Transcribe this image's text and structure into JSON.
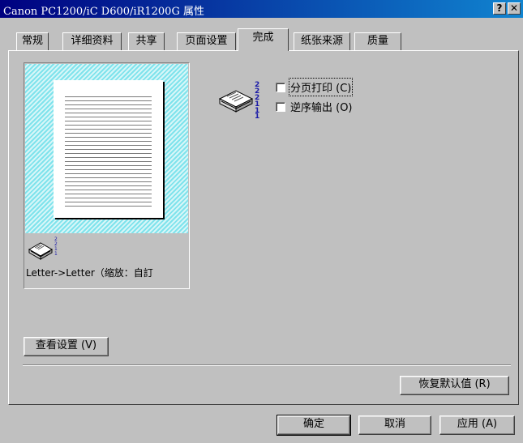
{
  "window": {
    "title": "Canon PC1200/iC D600/iR1200G 属性",
    "help_button": "?",
    "close_button": "✕"
  },
  "tabs": [
    {
      "label": "常规",
      "active": false
    },
    {
      "label": "详细资料",
      "active": false
    },
    {
      "label": "共享",
      "active": false
    },
    {
      "label": "页面设置",
      "active": false
    },
    {
      "label": "完成",
      "active": true
    },
    {
      "label": "纸张来源",
      "active": false
    },
    {
      "label": "质量",
      "active": false
    }
  ],
  "preview": {
    "caption": "Letter->Letter（缩放：自訂"
  },
  "options": {
    "collate_label": "分页打印 (C)",
    "collate_checked": false,
    "reverse_label": "逆序输出 (O)",
    "reverse_checked": false
  },
  "buttons": {
    "view_settings": "查看设置 (V)",
    "restore_defaults": "恢复默认值 (R)",
    "ok": "确定",
    "cancel": "取消",
    "apply": "应用 (A)"
  },
  "icons": {
    "stack_icon": "paper-stack-icon",
    "sort_numbers": "collation-numbers-icon"
  },
  "colors": {
    "titlebar_start": "#000080",
    "titlebar_end": "#1084d0",
    "dialog_face": "#c0c0c0",
    "preview_hatch": "#7fe3ec",
    "number_blue": "#1a1aa8"
  }
}
